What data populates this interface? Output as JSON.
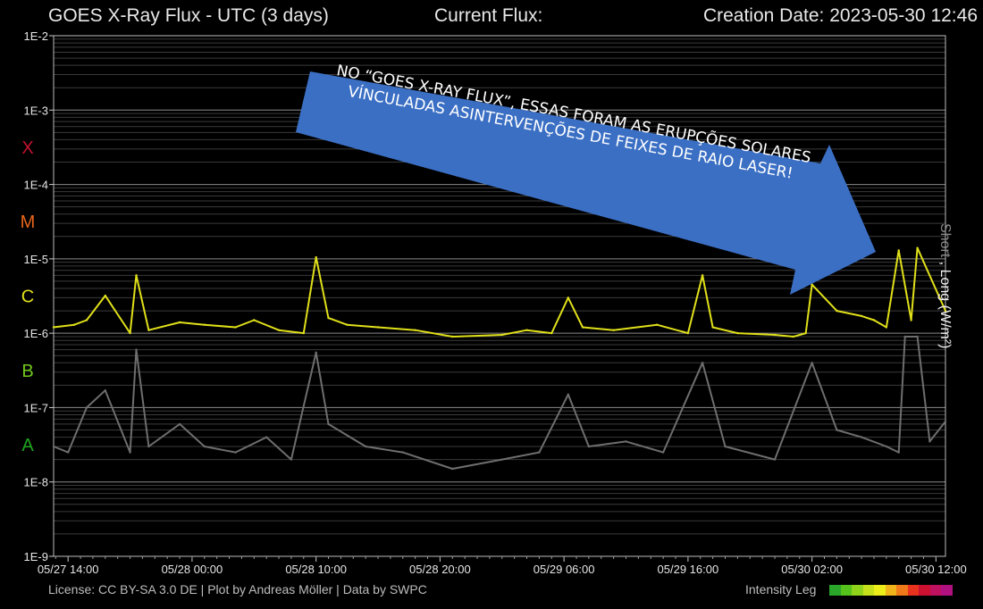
{
  "header": {
    "title": "GOES X-Ray Flux - UTC (3 days)",
    "current_flux": "Current Flux:",
    "creation_date": "Creation Date: 2023-05-30 12:46"
  },
  "y_ticks": [
    "1E-2",
    "1E-3",
    "1E-4",
    "1E-5",
    "1E-6",
    "1E-7",
    "1E-8",
    "1E-9"
  ],
  "flare_classes": [
    {
      "label": "X",
      "color": "#c4122f"
    },
    {
      "label": "M",
      "color": "#e8651a"
    },
    {
      "label": "C",
      "color": "#e0e01a"
    },
    {
      "label": "B",
      "color": "#72c81e"
    },
    {
      "label": "A",
      "color": "#1fa51f"
    }
  ],
  "y_axis_label": {
    "short": "Short",
    "sep": " , ",
    "long": "Long (W/m²)"
  },
  "footer": {
    "license": "License: CC BY-SA 3.0 DE | Plot by Andreas Möller | Data by SWPC",
    "legend_label": "Intensity Leg",
    "legend_colors": [
      "#2aa62a",
      "#56c21c",
      "#8fd41b",
      "#c6e01b",
      "#eded1a",
      "#f0b41a",
      "#f07a1a",
      "#e8321e",
      "#cc1030",
      "#c01060",
      "#b01080"
    ]
  },
  "annotation": {
    "text": "NO “GOES X-RAY FLUX”, ESSAS FORAM AS ERUPÇÕES SOLARES VÍNCULADAS ASINTERVENÇÕES DE FEIXES DE RAIO LASER!",
    "color": "#3b6fc4"
  },
  "chart_data": {
    "type": "line",
    "title": "GOES X-Ray Flux - UTC (3 days)",
    "ylabel": "Short , Long (W/m²)",
    "yscale": "log",
    "ylim": [
      1e-09,
      0.01
    ],
    "xlim": [
      "2023-05-27 12:50",
      "2023-05-30 12:46"
    ],
    "x_ticks": [
      "05/27 14:00",
      "05/28 00:00",
      "05/28 10:00",
      "05/28 20:00",
      "05/29 06:00",
      "05/29 16:00",
      "05/30 02:00",
      "05/30 12:00"
    ],
    "grid": true,
    "series": [
      {
        "name": "Long",
        "color": "#e0e01a",
        "x": [
          "2023-05-27 12:50",
          "2023-05-27 14:30",
          "2023-05-27 15:30",
          "2023-05-27 17:00",
          "2023-05-27 19:00",
          "2023-05-27 19:30",
          "2023-05-27 20:30",
          "2023-05-27 23:00",
          "2023-05-28 01:00",
          "2023-05-28 03:30",
          "2023-05-28 05:00",
          "2023-05-28 07:00",
          "2023-05-28 09:00",
          "2023-05-28 10:00",
          "2023-05-28 11:00",
          "2023-05-28 12:30",
          "2023-05-28 15:00",
          "2023-05-28 18:00",
          "2023-05-28 21:00",
          "2023-05-29 01:00",
          "2023-05-29 03:00",
          "2023-05-29 05:00",
          "2023-05-29 06:20",
          "2023-05-29 07:30",
          "2023-05-29 10:00",
          "2023-05-29 13:30",
          "2023-05-29 16:00",
          "2023-05-29 17:10",
          "2023-05-29 18:00",
          "2023-05-29 20:00",
          "2023-05-29 23:00",
          "2023-05-30 00:30",
          "2023-05-30 01:30",
          "2023-05-30 02:00",
          "2023-05-30 04:00",
          "2023-05-30 06:00",
          "2023-05-30 07:00",
          "2023-05-30 08:00",
          "2023-05-30 09:00",
          "2023-05-30 10:00",
          "2023-05-30 10:30",
          "2023-05-30 12:46"
        ],
        "values": [
          1.2e-06,
          1.3e-06,
          1.5e-06,
          3.2e-06,
          1e-06,
          6e-06,
          1.1e-06,
          1.4e-06,
          1.3e-06,
          1.2e-06,
          1.5e-06,
          1.1e-06,
          1e-06,
          1.05e-05,
          1.6e-06,
          1.3e-06,
          1.2e-06,
          1.1e-06,
          9e-07,
          9.5e-07,
          1.1e-06,
          1e-06,
          3e-06,
          1.2e-06,
          1.1e-06,
          1.3e-06,
          1e-06,
          6e-06,
          1.2e-06,
          1e-06,
          9.5e-07,
          9e-07,
          1e-06,
          4.5e-06,
          2e-06,
          1.7e-06,
          1.5e-06,
          1.2e-06,
          1.3e-05,
          1.5e-06,
          1.4e-05,
          2e-06
        ]
      },
      {
        "name": "Short",
        "color": "#6e6e6e",
        "x": [
          "2023-05-27 12:50",
          "2023-05-27 14:00",
          "2023-05-27 15:30",
          "2023-05-27 17:00",
          "2023-05-27 19:00",
          "2023-05-27 19:30",
          "2023-05-27 20:30",
          "2023-05-27 23:00",
          "2023-05-28 01:00",
          "2023-05-28 03:30",
          "2023-05-28 06:00",
          "2023-05-28 08:00",
          "2023-05-28 10:00",
          "2023-05-28 11:00",
          "2023-05-28 14:00",
          "2023-05-28 17:00",
          "2023-05-28 21:00",
          "2023-05-29 01:00",
          "2023-05-29 04:00",
          "2023-05-29 06:20",
          "2023-05-29 08:00",
          "2023-05-29 11:00",
          "2023-05-29 14:00",
          "2023-05-29 17:10",
          "2023-05-29 19:00",
          "2023-05-29 23:00",
          "2023-05-30 02:00",
          "2023-05-30 04:00",
          "2023-05-30 06:00",
          "2023-05-30 08:00",
          "2023-05-30 09:00",
          "2023-05-30 09:30",
          "2023-05-30 10:30",
          "2023-05-30 11:30",
          "2023-05-30 12:46"
        ],
        "values": [
          3e-08,
          2.5e-08,
          1e-07,
          1.7e-07,
          2.5e-08,
          6e-07,
          3e-08,
          6e-08,
          3e-08,
          2.5e-08,
          4e-08,
          2e-08,
          5.5e-07,
          6e-08,
          3e-08,
          2.5e-08,
          1.5e-08,
          2e-08,
          2.5e-08,
          1.5e-07,
          3e-08,
          3.5e-08,
          2.5e-08,
          4e-07,
          3e-08,
          2e-08,
          4e-07,
          5e-08,
          4e-08,
          3e-08,
          2.5e-08,
          9e-07,
          9e-07,
          3.5e-08,
          6.5e-08
        ]
      }
    ]
  }
}
